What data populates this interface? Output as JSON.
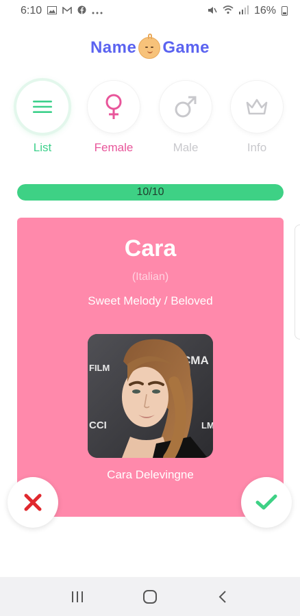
{
  "status_bar": {
    "time": "6:10",
    "battery": "16%",
    "left_icons": [
      "gallery-icon",
      "gmail-icon",
      "facebook-icon",
      "more-icon"
    ],
    "right_icons": [
      "mute-icon",
      "wifi-icon",
      "signal-icon",
      "battery-icon"
    ]
  },
  "logo": {
    "word_left": "Name",
    "word_right": "Game",
    "color": "#5b63f0"
  },
  "tabs": [
    {
      "label": "List",
      "icon": "list-icon",
      "color": "#3cd08a",
      "active": true
    },
    {
      "label": "Female",
      "icon": "female-icon",
      "color": "#e8559a",
      "active": false
    },
    {
      "label": "Male",
      "icon": "male-icon",
      "color": "#c8c8cc",
      "active": false
    },
    {
      "label": "Info",
      "icon": "crown-icon",
      "color": "#c8c8cc",
      "active": false
    }
  ],
  "progress": {
    "text": "10/10",
    "current": 10,
    "total": 10,
    "fraction": 1.0,
    "color": "#3ed185"
  },
  "card": {
    "name": "Cara",
    "origin": "(Italian)",
    "meaning": "Sweet Melody / Beloved",
    "photo_caption": "Cara Delevingne",
    "background_color": "#ff89ab",
    "photo_backdrop_text": [
      "FILM",
      "CMA",
      "CCI",
      "LM"
    ]
  },
  "actions": {
    "reject_icon": "close-icon",
    "reject_color": "#e0282e",
    "accept_icon": "check-icon",
    "accept_color": "#3ed185"
  },
  "nav_bar": {
    "icons": [
      "recent-apps-icon",
      "home-icon",
      "back-icon"
    ]
  }
}
